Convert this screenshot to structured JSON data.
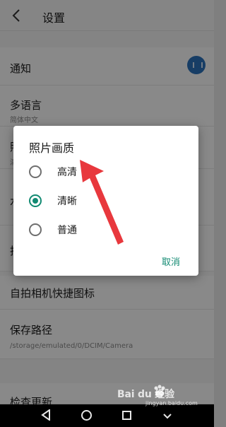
{
  "header": {
    "title": "设置"
  },
  "settings": {
    "notify_label": "通知",
    "language_label": "多语言",
    "language_value": "简体中文",
    "row3_partial": "照",
    "row3_sub_partial": "清",
    "row4_partial": "水",
    "row5_partial": "拍",
    "selfie_shortcut_label": "自拍相机快捷图标",
    "save_path_label": "保存路径",
    "save_path_value": "/storage/emulated/0/DCIM/Camera",
    "check_update_label": "检查更新"
  },
  "dialog": {
    "title": "照片画质",
    "options": [
      {
        "label": "高清",
        "selected": false
      },
      {
        "label": "清晰",
        "selected": true
      },
      {
        "label": "普通",
        "selected": false
      }
    ],
    "cancel_label": "取消"
  },
  "watermark": {
    "text": "Bai du 经验",
    "url": "jingyan.baidu.com"
  },
  "colors": {
    "accent": "#128a72",
    "toggle": "#2b6fb8",
    "arrow": "#e8383d"
  },
  "icons": [
    "back-arrow-icon",
    "speaker-toggle-icon",
    "nav-back-icon",
    "nav-home-icon",
    "nav-recent-icon",
    "nav-menu-icon",
    "baidu-paw-icon"
  ]
}
